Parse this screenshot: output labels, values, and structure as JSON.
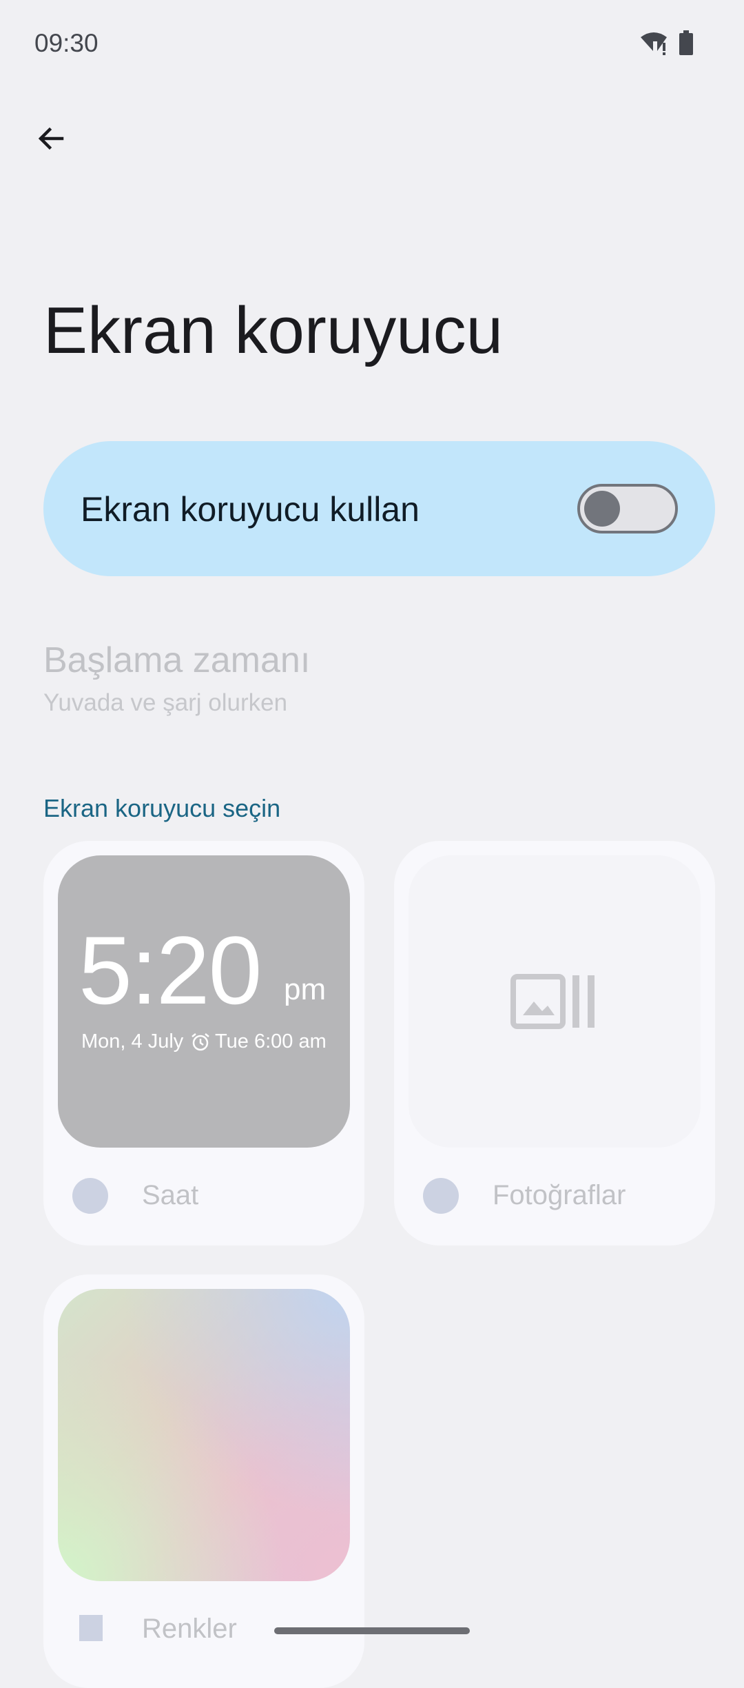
{
  "status_bar": {
    "time": "09:30",
    "icons": [
      "wifi-alert-icon",
      "battery-icon"
    ]
  },
  "header": {
    "back_icon": "arrow-back-icon",
    "title": "Ekran koruyucu"
  },
  "main_toggle": {
    "label": "Ekran koruyucu kullan",
    "state": "off",
    "background_color": "#c2e6fb"
  },
  "start_time": {
    "title": "Başlama zamanı",
    "subtitle": "Yuvada ve şarj olurken"
  },
  "section": {
    "heading": "Ekran koruyucu seçin",
    "accent_color": "#1a6584"
  },
  "options": [
    {
      "label": "Saat",
      "preview": {
        "time": "5:20",
        "ampm": "pm",
        "date": "Mon, 4 July",
        "alarm_icon": "alarm-icon",
        "alarm": "Tue 6:00 am"
      }
    },
    {
      "label": "Fotoğraflar",
      "preview": {
        "icon": "photo-library-icon"
      }
    },
    {
      "label": "Renkler",
      "preview": {
        "type": "gradient"
      }
    }
  ]
}
